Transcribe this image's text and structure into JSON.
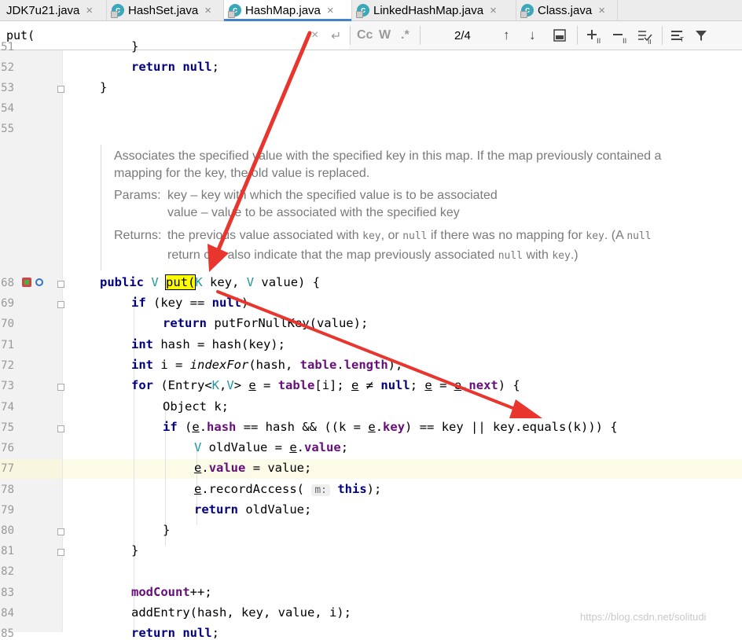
{
  "tabs": [
    {
      "label": "JDK7u21.java",
      "close": "×"
    },
    {
      "label": "HashSet.java",
      "close": "×"
    },
    {
      "label": "HashMap.java",
      "close": "×"
    },
    {
      "label": "LinkedHashMap.java",
      "close": "×"
    },
    {
      "label": "Class.java",
      "close": "×"
    }
  ],
  "search": {
    "value": "put(",
    "clear_icon": "×",
    "enter_icon": "↵",
    "case_label": "Cc",
    "word_label": "W",
    "regex_label": ".*",
    "match_count": "2/4"
  },
  "toolbar_icons": [
    "up-arrow",
    "down-arrow",
    "select-all",
    "add-occurrence",
    "remove-occurrence",
    "select-all-occurrences",
    "filter-options",
    "filter"
  ],
  "line_numbers": {
    "l51": "51",
    "l52": "52",
    "l53": "53",
    "l54": "54",
    "l55": "55",
    "l68": "68",
    "l69": "69",
    "l70": "70",
    "l71": "71",
    "l72": "72",
    "l73": "73",
    "l74": "74",
    "l75": "75",
    "l76": "76",
    "l77": "77",
    "l78": "78",
    "l79": "79",
    "l80": "80",
    "l81": "81",
    "l82": "82",
    "l83": "83",
    "l84": "84",
    "l85": "85"
  },
  "javadoc": {
    "line1": "Associates the specified value with the specified key in this map. If the map previously contained a",
    "line2": "mapping for the key, the old value is replaced.",
    "params_label": "Params:",
    "param1": "key – key with which the specified value is to be associated",
    "param2": "value – value to be associated with the specified key",
    "returns_label": "Returns:",
    "returns_a": "the previous value associated with ",
    "returns_key": "key",
    "returns_b": ", or ",
    "returns_null": "null",
    "returns_c": " if there was no mapping for ",
    "returns_key2": "key",
    "returns_d": ". (A ",
    "returns_null2": "null",
    "returns2_a": "return can also indicate that the map previously associated ",
    "returns2_null": "null",
    "returns2_b": " with ",
    "returns2_key": "key",
    "returns2_c": ".)"
  },
  "watermark": "https://blog.csdn.net/solitudi",
  "colors": {
    "keyword": "#000080",
    "field": "#660e7a",
    "type_param": "#20999d",
    "highlight": "#ffff00",
    "arrow": "#e8352e",
    "tab_underline": "#4083c9"
  }
}
